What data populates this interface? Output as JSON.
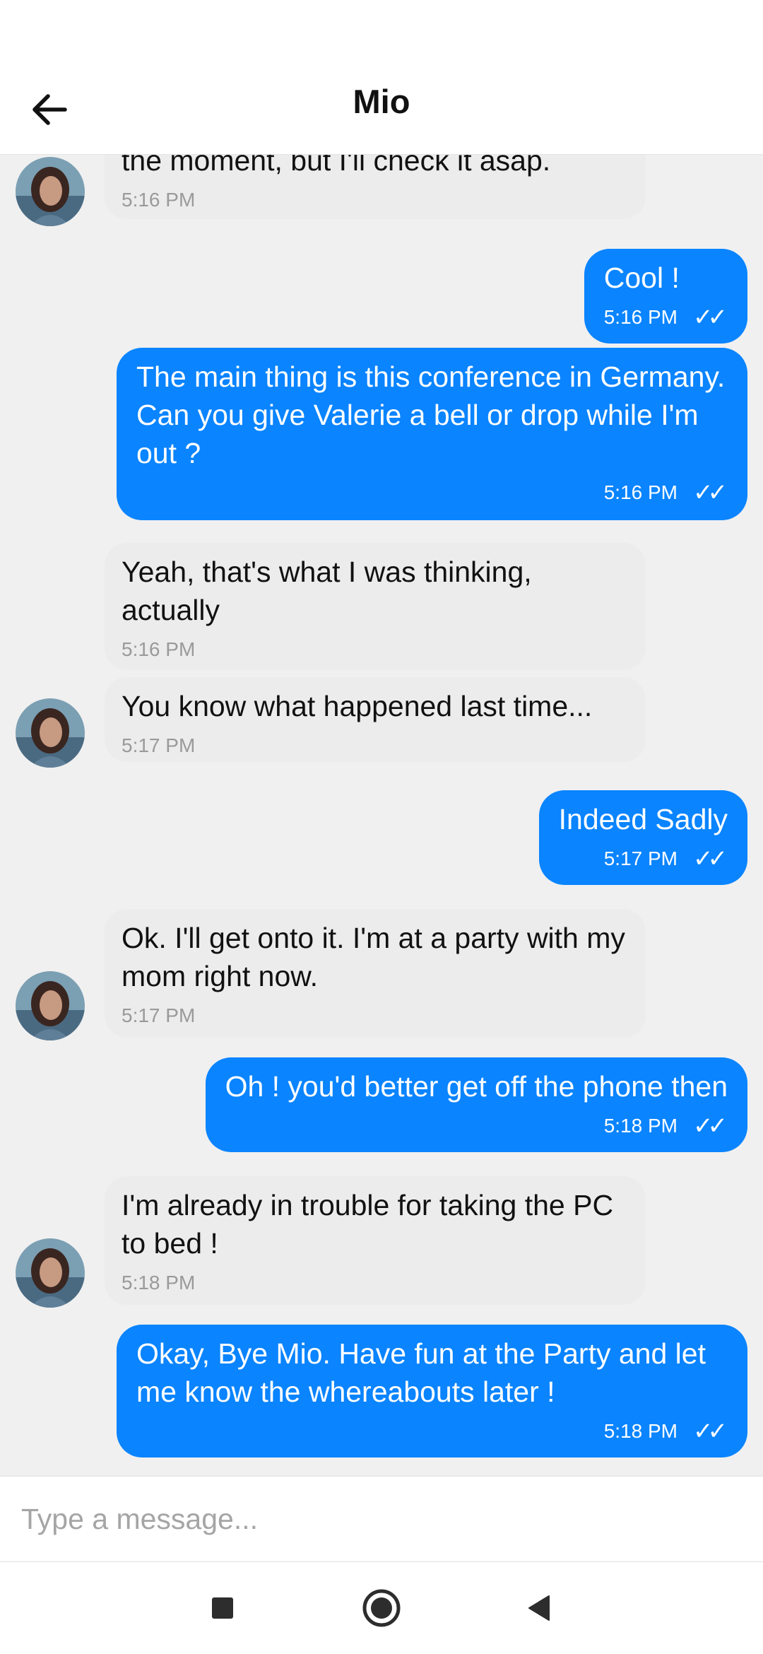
{
  "header": {
    "title": "Mio"
  },
  "messages": [
    {
      "dir": "in",
      "text": "the moment, but I'll check it asap.",
      "time": "5:16 PM",
      "ticks": ""
    },
    {
      "dir": "out",
      "text": "Cool !",
      "time": "5:16 PM",
      "ticks": "✓✓"
    },
    {
      "dir": "out",
      "text": "The main thing is this conference in Germany. Can you give Valerie a bell or drop while I'm out ?",
      "time": "5:16 PM",
      "ticks": "✓✓"
    },
    {
      "dir": "in",
      "text": "Yeah, that's what I was thinking, actually",
      "time": "5:16 PM",
      "ticks": ""
    },
    {
      "dir": "in",
      "text": "You know what happened last time...",
      "time": "5:17 PM",
      "ticks": ""
    },
    {
      "dir": "out",
      "text": "Indeed Sadly",
      "time": "5:17 PM",
      "ticks": "✓✓"
    },
    {
      "dir": "in",
      "text": "Ok. I'll get onto it. I'm at a party with my mom right now.",
      "time": "5:17 PM",
      "ticks": ""
    },
    {
      "dir": "out",
      "text": "Oh ! you'd better get off the phone then",
      "time": "5:18 PM",
      "ticks": "✓✓"
    },
    {
      "dir": "in",
      "text": "I'm already in trouble for taking the PC to bed !",
      "time": "5:18 PM",
      "ticks": ""
    },
    {
      "dir": "out",
      "text": "Okay, Bye Mio. Have fun at the Party and let me know the whereabouts later !",
      "time": "5:18 PM",
      "ticks": "✓✓"
    }
  ],
  "composer": {
    "placeholder": "Type a message...",
    "value": ""
  },
  "colors": {
    "outgoing": "#0a84ff",
    "incoming": "#ececec",
    "background": "#f0f0f0"
  },
  "icons": {
    "back": "arrow-left-icon",
    "nav": [
      "square-icon",
      "circle-icon",
      "triangle-left-icon"
    ]
  }
}
